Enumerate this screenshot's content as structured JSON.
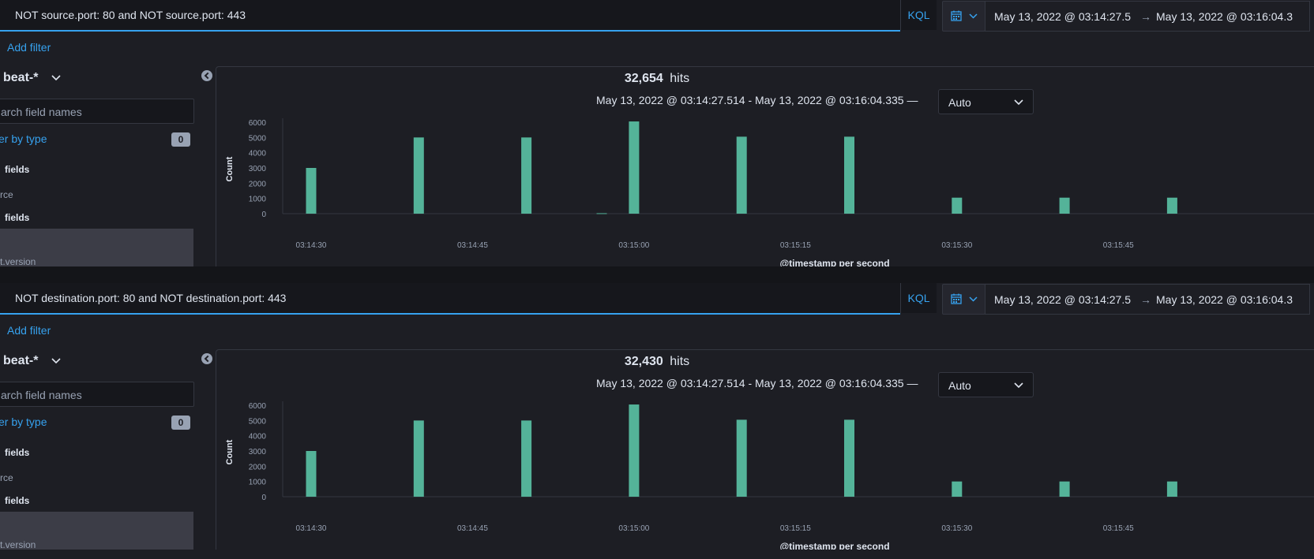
{
  "panels": [
    {
      "query": "NOT source.port: 80 and NOT source.port: 443",
      "kql": "KQL",
      "date_start": "May 13, 2022 @ 03:14:27.5",
      "date_arrow": "→",
      "date_end": "May 13, 2022 @ 03:16:04.3",
      "add_filter": "Add filter",
      "index_pattern": "beat-*",
      "field_search_placeholder": "arch field names",
      "filter_by_type": "er by type",
      "filter_count": "0",
      "section_selected": "fields",
      "field_item": "rce",
      "section_available": "fields",
      "hover_field": "t.version",
      "hits_count": "32,654",
      "hits_label": "hits",
      "time_range": "May 13, 2022 @ 03:14:27.514 - May 13, 2022 @ 03:16:04.335 —",
      "interval": "Auto"
    },
    {
      "query": "NOT destination.port: 80 and NOT destination.port: 443",
      "kql": "KQL",
      "date_start": "May 13, 2022 @ 03:14:27.5",
      "date_arrow": "→",
      "date_end": "May 13, 2022 @ 03:16:04.3",
      "add_filter": "Add filter",
      "index_pattern": "beat-*",
      "field_search_placeholder": "arch field names",
      "filter_by_type": "er by type",
      "filter_count": "0",
      "section_selected": "fields",
      "field_item": "rce",
      "section_available": "fields",
      "hover_field": "t.version",
      "hits_count": "32,430",
      "hits_label": "hits",
      "time_range": "May 13, 2022 @ 03:14:27.514 - May 13, 2022 @ 03:16:04.335 —",
      "interval": "Auto"
    }
  ],
  "colors": {
    "bar": "#54b399",
    "accent": "#36a2ef",
    "background": "#1d1e24"
  },
  "chart_data": [
    {
      "type": "bar",
      "title": "",
      "xlabel": "@timestamp per second",
      "ylabel": "Count",
      "ylim": [
        0,
        6000
      ],
      "yticks": [
        0,
        1000,
        2000,
        3000,
        4000,
        5000,
        6000
      ],
      "xtick_labels": [
        "03:14:30",
        "03:14:45",
        "03:15:00",
        "03:15:15",
        "03:15:30",
        "03:15:45"
      ],
      "xtick_seconds": [
        30,
        45,
        60,
        75,
        90,
        105
      ],
      "x_seconds": [
        30,
        40,
        50,
        57,
        60,
        70,
        80,
        90,
        100,
        110
      ],
      "values": [
        3000,
        5000,
        5000,
        30,
        6050,
        5050,
        5050,
        1050,
        1050,
        1050
      ]
    },
    {
      "type": "bar",
      "title": "",
      "xlabel": "@timestamp per second",
      "ylabel": "Count",
      "ylim": [
        0,
        6000
      ],
      "yticks": [
        0,
        1000,
        2000,
        3000,
        4000,
        5000,
        6000
      ],
      "xtick_labels": [
        "03:14:30",
        "03:14:45",
        "03:15:00",
        "03:15:15",
        "03:15:30",
        "03:15:45"
      ],
      "xtick_seconds": [
        30,
        45,
        60,
        75,
        90,
        105
      ],
      "x_seconds": [
        30,
        40,
        50,
        60,
        70,
        80,
        90,
        100,
        110
      ],
      "values": [
        3000,
        5000,
        5000,
        6050,
        5050,
        5050,
        1000,
        1000,
        1000
      ]
    }
  ]
}
